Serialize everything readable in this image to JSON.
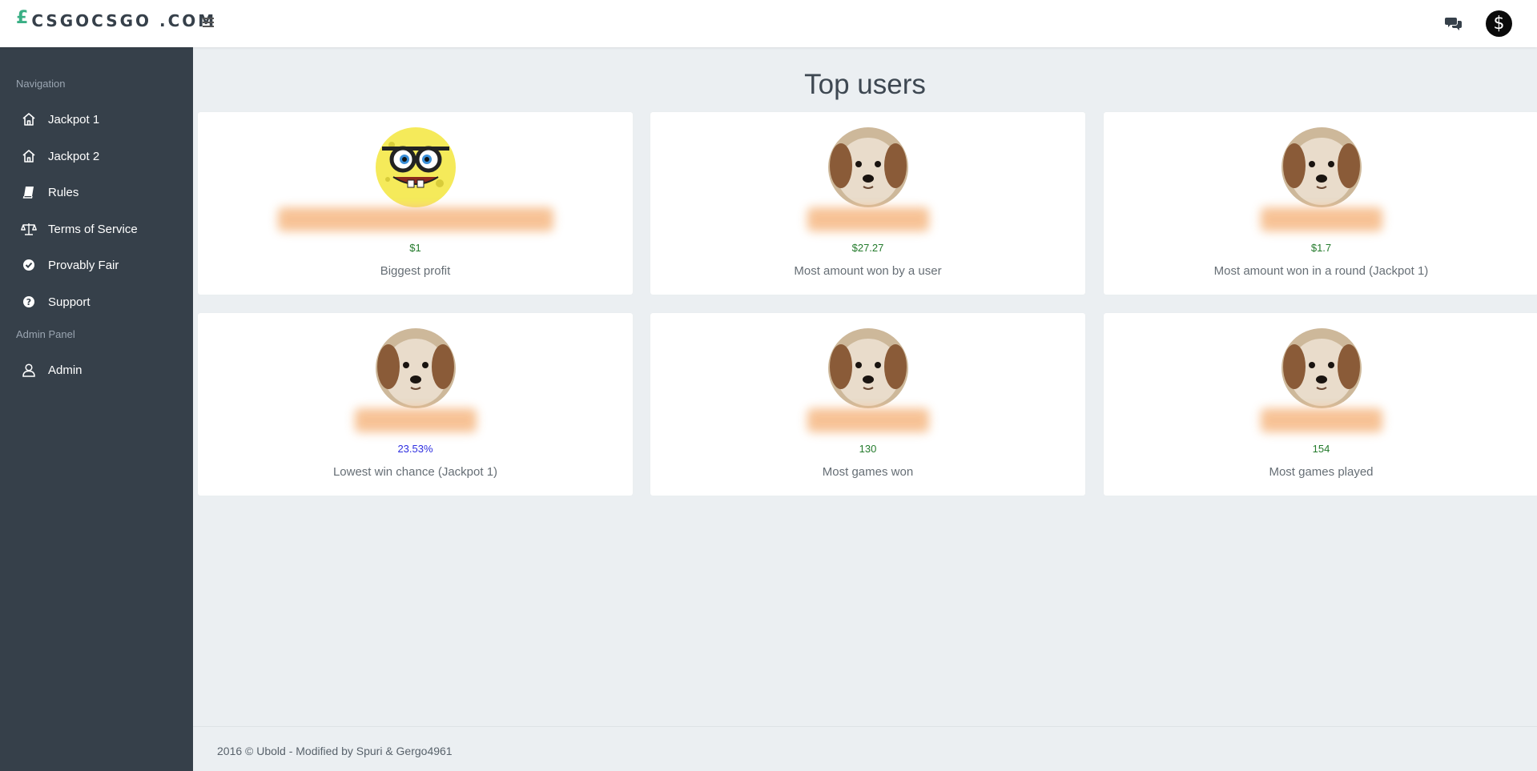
{
  "header": {
    "logo_symbol": "£",
    "logo_text": "CSGOCSGO .COM"
  },
  "sidebar": {
    "sections": [
      {
        "heading": "Navigation"
      },
      {
        "heading": "Admin Panel"
      }
    ],
    "items": [
      {
        "label": "Jackpot 1",
        "icon": "home-icon"
      },
      {
        "label": "Jackpot 2",
        "icon": "home-icon"
      },
      {
        "label": "Rules",
        "icon": "book-icon"
      },
      {
        "label": "Terms of Service",
        "icon": "scale-icon"
      },
      {
        "label": "Provably Fair",
        "icon": "check-circle-icon"
      },
      {
        "label": "Support",
        "icon": "question-circle-icon"
      },
      {
        "label": "Admin",
        "icon": "user-icon"
      }
    ]
  },
  "main": {
    "title": "Top users",
    "cards": [
      {
        "avatar": "spongebob-avatar",
        "value": "$1",
        "description": "Biggest profit"
      },
      {
        "avatar": "dog-avatar",
        "value": "$27.27",
        "description": "Most amount won by a user"
      },
      {
        "avatar": "dog-avatar",
        "value": "$1.7",
        "description": "Most amount won in a round (Jackpot 1)"
      },
      {
        "avatar": "dog-avatar",
        "value": "23.53%",
        "description": "Lowest win chance (Jackpot 1)"
      },
      {
        "avatar": "dog-avatar",
        "value": "130",
        "description": "Most games won"
      },
      {
        "avatar": "dog-avatar",
        "value": "154",
        "description": "Most games played"
      }
    ]
  },
  "footer": {
    "text": "2016 © Ubold - Modified by Spuri & Gergo4961"
  },
  "colors": {
    "sidebar_bg": "#36404a",
    "content_bg": "#ebeff2",
    "accent_green": "#3aaf85",
    "value_green": "#237a2b",
    "value_blue": "#2e2ee0"
  }
}
